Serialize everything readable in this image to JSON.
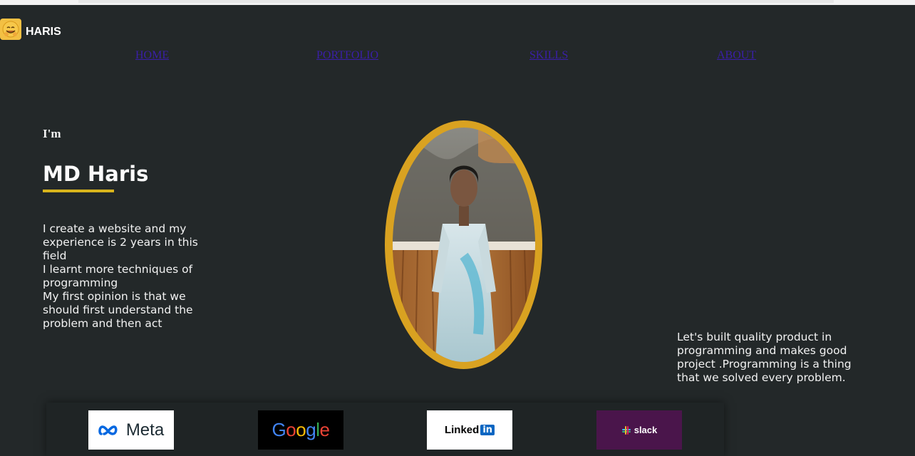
{
  "brand": {
    "title": "HARIS",
    "icon": "smiling-face-icon"
  },
  "nav": {
    "items": [
      "HOME",
      "PORTFOLIO",
      "SKILLS",
      "ABOUT"
    ]
  },
  "hero": {
    "intro": "I'm",
    "name": "MD Haris",
    "bio_lines": [
      "I create a website and my",
      "experience is 2 years in this",
      "field",
      "I learnt more techniques of",
      "programming",
      "My first opinion is that we",
      "should first understand the",
      "problem and then act"
    ],
    "right_lines": [
      "Let's built quality product in",
      "programming and makes good",
      "project .Programming is a thing",
      "that we solved every problem."
    ]
  },
  "logos": {
    "meta": "Meta",
    "google": [
      "G",
      "o",
      "o",
      "g",
      "l",
      "e"
    ],
    "linkedin_text": "Linked",
    "linkedin_box": "in",
    "slack": "slack"
  },
  "colors": {
    "background": "#232829",
    "accent": "#d9a221",
    "underline": "#d8b41c",
    "nav_link": "#3a1fa8"
  }
}
